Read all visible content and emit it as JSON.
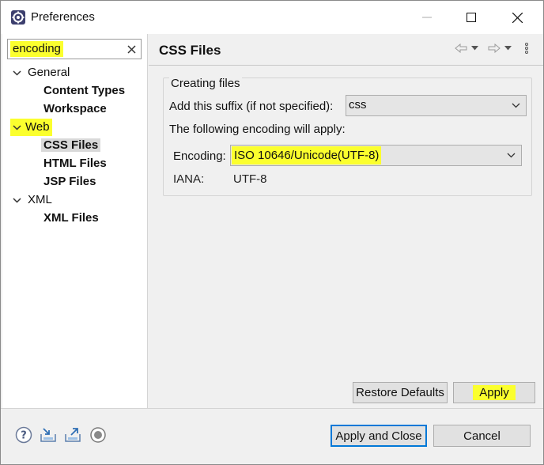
{
  "window": {
    "title": "Preferences",
    "icon": "preferences-gear-icon"
  },
  "filter": {
    "value": "encoding",
    "highlight_color": "#fbff2e"
  },
  "tree": [
    {
      "label": "General",
      "expanded": true,
      "highlighted": false,
      "children": [
        {
          "label": "Content Types"
        },
        {
          "label": "Workspace"
        }
      ]
    },
    {
      "label": "Web",
      "expanded": true,
      "highlighted": true,
      "children": [
        {
          "label": "CSS Files",
          "selected": true
        },
        {
          "label": "HTML Files"
        },
        {
          "label": "JSP Files"
        }
      ]
    },
    {
      "label": "XML",
      "expanded": true,
      "highlighted": false,
      "children": [
        {
          "label": "XML Files"
        }
      ]
    }
  ],
  "page": {
    "title": "CSS Files",
    "group_title": "Creating files",
    "suffix_label": "Add this suffix (if not specified):",
    "suffix_value": "css",
    "encoding_note": "The following encoding will apply:",
    "encoding_label": "Encoding:",
    "encoding_value": "ISO 10646/Unicode(UTF-8)",
    "iana_label": "IANA:",
    "iana_value": "UTF-8"
  },
  "buttons": {
    "restore_defaults": "Restore Defaults",
    "apply": "Apply",
    "apply_and_close": "Apply and Close",
    "cancel": "Cancel"
  },
  "colors": {
    "highlight": "#fbff2e",
    "default_button_border": "#0078d7",
    "selection": "#d9d9d9"
  }
}
